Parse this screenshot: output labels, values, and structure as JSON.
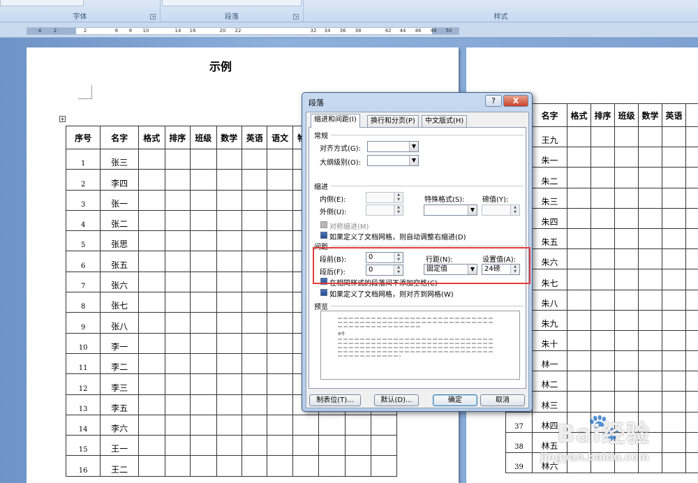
{
  "ribbon": {
    "groups": [
      {
        "label": "字体"
      },
      {
        "label": "段落"
      },
      {
        "label": "样式"
      }
    ]
  },
  "ruler": {
    "ticks": [
      "4",
      "2",
      "2",
      "6",
      "8",
      "10",
      "14",
      "16",
      "20",
      "22",
      "32",
      "34",
      "36",
      "38",
      "42",
      "44",
      "46",
      "48",
      "50"
    ]
  },
  "document": {
    "title": "示例",
    "left_table": {
      "headers": [
        "序号",
        "名字",
        "格式",
        "排序",
        "班级",
        "数学",
        "英语",
        "语文",
        "物理"
      ],
      "rows": [
        [
          "1",
          "张三"
        ],
        [
          "2",
          "李四"
        ],
        [
          "3",
          "张一"
        ],
        [
          "4",
          "张二"
        ],
        [
          "5",
          "张思"
        ],
        [
          "6",
          "张五"
        ],
        [
          "7",
          "张六"
        ],
        [
          "8",
          "张七"
        ],
        [
          "9",
          "张八"
        ],
        [
          "10",
          "李一"
        ],
        [
          "11",
          "李二"
        ],
        [
          "12",
          "李三"
        ],
        [
          "13",
          "李五"
        ],
        [
          "14",
          "李六"
        ],
        [
          "15",
          "王一"
        ],
        [
          "16",
          "王二"
        ]
      ]
    },
    "right_table": {
      "headers": [
        "名字",
        "格式",
        "排序",
        "班级",
        "数学",
        "英语"
      ],
      "rows": [
        [
          "",
          "王九"
        ],
        [
          "",
          "朱一"
        ],
        [
          "",
          "朱二"
        ],
        [
          "",
          "朱三"
        ],
        [
          "",
          "朱四"
        ],
        [
          "",
          "朱五"
        ],
        [
          "",
          "朱六"
        ],
        [
          "",
          "朱七"
        ],
        [
          "",
          "朱八"
        ],
        [
          "",
          "朱九"
        ],
        [
          "",
          "朱十"
        ],
        [
          "",
          "林一"
        ],
        [
          "",
          "林二"
        ],
        [
          "",
          "林三"
        ],
        [
          "37",
          "林四"
        ],
        [
          "38",
          "林五"
        ],
        [
          "39",
          "林六"
        ]
      ]
    }
  },
  "dialog": {
    "title": "段落",
    "help": "?",
    "close": "X",
    "tabs": [
      "缩进和间距(I)",
      "换行和分页(P)",
      "中文版式(H)"
    ],
    "general": {
      "heading": "常规",
      "alignment_label": "对齐方式(G):",
      "outline_label": "大纲级别(O):"
    },
    "indent": {
      "heading": "缩进",
      "inner_label": "内侧(E):",
      "outer_label": "外侧(U):",
      "special_label": "特殊格式(S):",
      "measure_label": "磅值(Y):",
      "mirror_label": "对称缩进(M)",
      "auto_adjust_label": "如果定义了文档网格，则自动调整右缩进(D)"
    },
    "spacing": {
      "heading": "间距",
      "before_label": "段前(B):",
      "before_value": "0",
      "after_label": "段后(F):",
      "after_value": "0",
      "line_spacing_label": "行距(N):",
      "line_spacing_value": "固定值",
      "at_label": "设置值(A):",
      "at_value": "24磅",
      "no_space_same_style_label": "在相同样式的段落间不添加空格(C)",
      "snap_to_grid_label": "如果定义了文档网格，则对齐到网格(W)"
    },
    "preview": {
      "heading": "预览",
      "sample": "序号"
    },
    "buttons": {
      "tabs": "制表位(T)...",
      "default": "默认(D)...",
      "ok": "确定",
      "cancel": "取消"
    }
  },
  "watermark": {
    "text": "Bai经验",
    "url": "jingyan.baidu.com"
  }
}
